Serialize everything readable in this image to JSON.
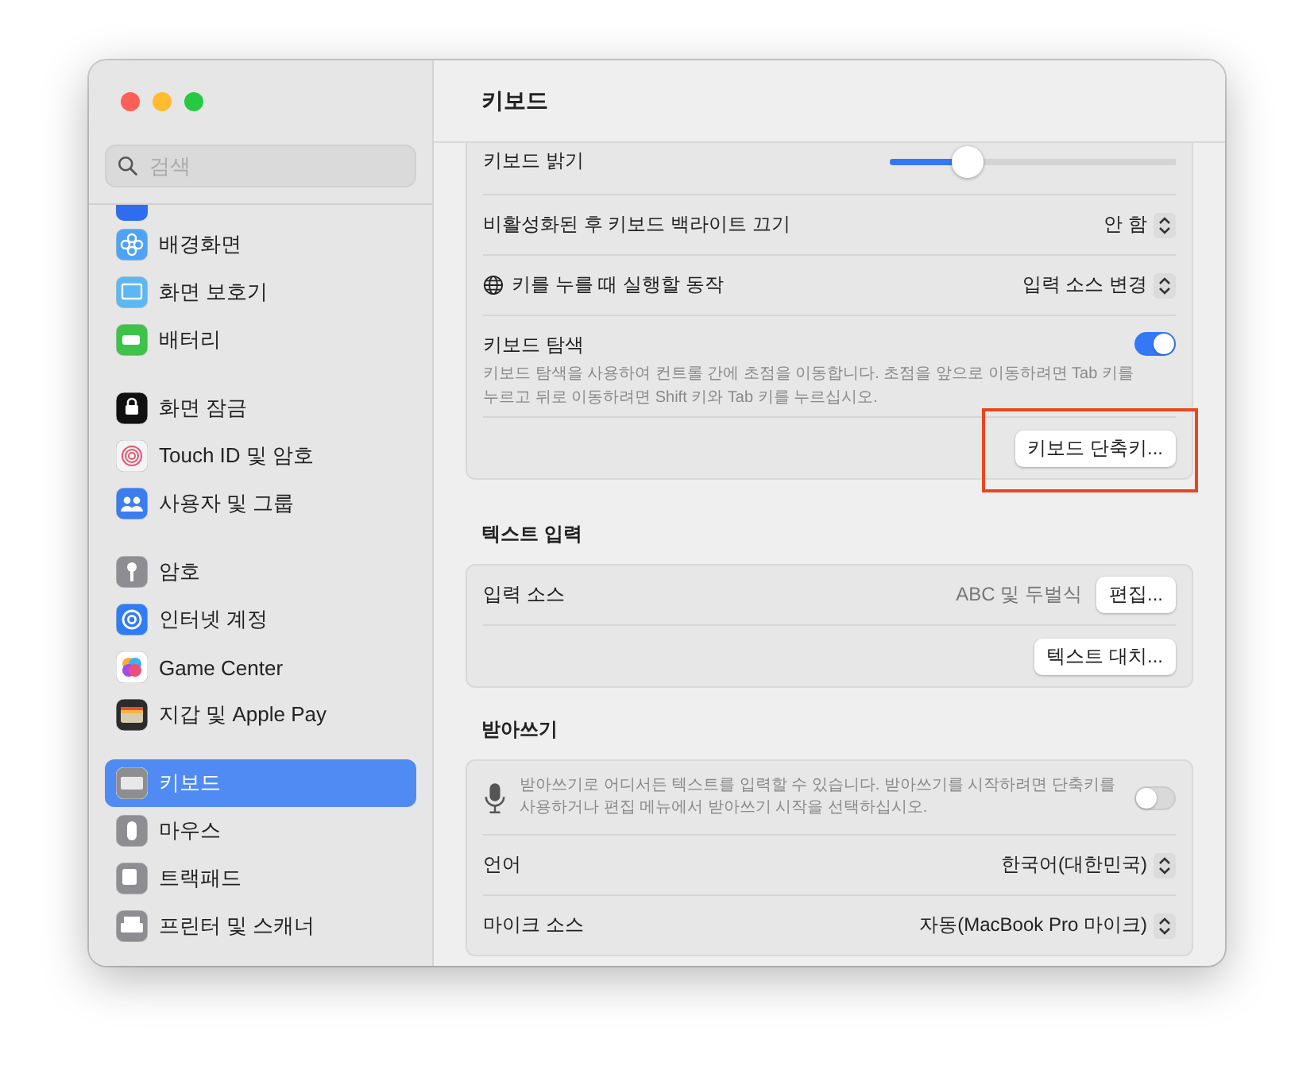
{
  "sidebar": {
    "search": {
      "placeholder": "검색"
    },
    "groups": [
      {
        "items": [
          {
            "label": "배경화면",
            "selected": false
          },
          {
            "label": "화면 보호기",
            "selected": false
          },
          {
            "label": "배터리",
            "selected": false
          }
        ]
      },
      {
        "items": [
          {
            "label": "화면 잠금",
            "selected": false
          },
          {
            "label": "Touch ID 및 암호",
            "selected": false
          },
          {
            "label": "사용자 및 그룹",
            "selected": false
          }
        ]
      },
      {
        "items": [
          {
            "label": "암호",
            "selected": false
          },
          {
            "label": "인터넷 계정",
            "selected": false
          },
          {
            "label": "Game Center",
            "selected": false
          },
          {
            "label": "지갑 및 Apple Pay",
            "selected": false
          }
        ]
      },
      {
        "items": [
          {
            "label": "키보드",
            "selected": true
          },
          {
            "label": "마우스",
            "selected": false
          },
          {
            "label": "트랙패드",
            "selected": false
          },
          {
            "label": "프린터 및 스캐너",
            "selected": false
          }
        ]
      }
    ]
  },
  "page": {
    "title": "키보드"
  },
  "sections": [
    {
      "rows": [
        {
          "kind": "slider",
          "label": "키보드 밝기",
          "level": 0.27
        },
        {
          "kind": "popup",
          "label": "비활성화된 후 키보드 백라이트 끄기",
          "value": "안 함"
        },
        {
          "kind": "popup_globe",
          "label": "키를 누를 때 실행할 동작",
          "value": "입력 소스 변경"
        },
        {
          "kind": "toggle",
          "label": "키보드 탐색",
          "description": "키보드 탐색을 사용하여 컨트롤 간에 초점을 이동합니다. 초점을 앞으로 이동하려면 Tab 키를 누르고 뒤로 이동하려면 Shift 키와 Tab 키를 누르십시오.",
          "on": true
        },
        {
          "kind": "button",
          "button": "키보드 단축키...",
          "highlighted": true
        }
      ]
    },
    {
      "heading": "텍스트 입력",
      "rows": [
        {
          "kind": "value_button",
          "label": "입력 소스",
          "value": "ABC 및 두벌식",
          "button": "편집..."
        },
        {
          "kind": "button",
          "button": "텍스트 대치...",
          "highlighted": false
        }
      ]
    },
    {
      "heading": "받아쓰기",
      "rows": [
        {
          "kind": "mic_toggle",
          "description": "받아쓰기로 어디서든 텍스트를 입력할 수 있습니다. 받아쓰기를 시작하려면 단축키를 사용하거나 편집 메뉴에서 받아쓰기 시작을 선택하십시오.",
          "on": false
        },
        {
          "kind": "popup",
          "label": "언어",
          "value": "한국어(대한민국)"
        },
        {
          "kind": "popup",
          "label": "마이크 소스",
          "value": "자동(MacBook Pro 마이크)"
        }
      ]
    }
  ]
}
